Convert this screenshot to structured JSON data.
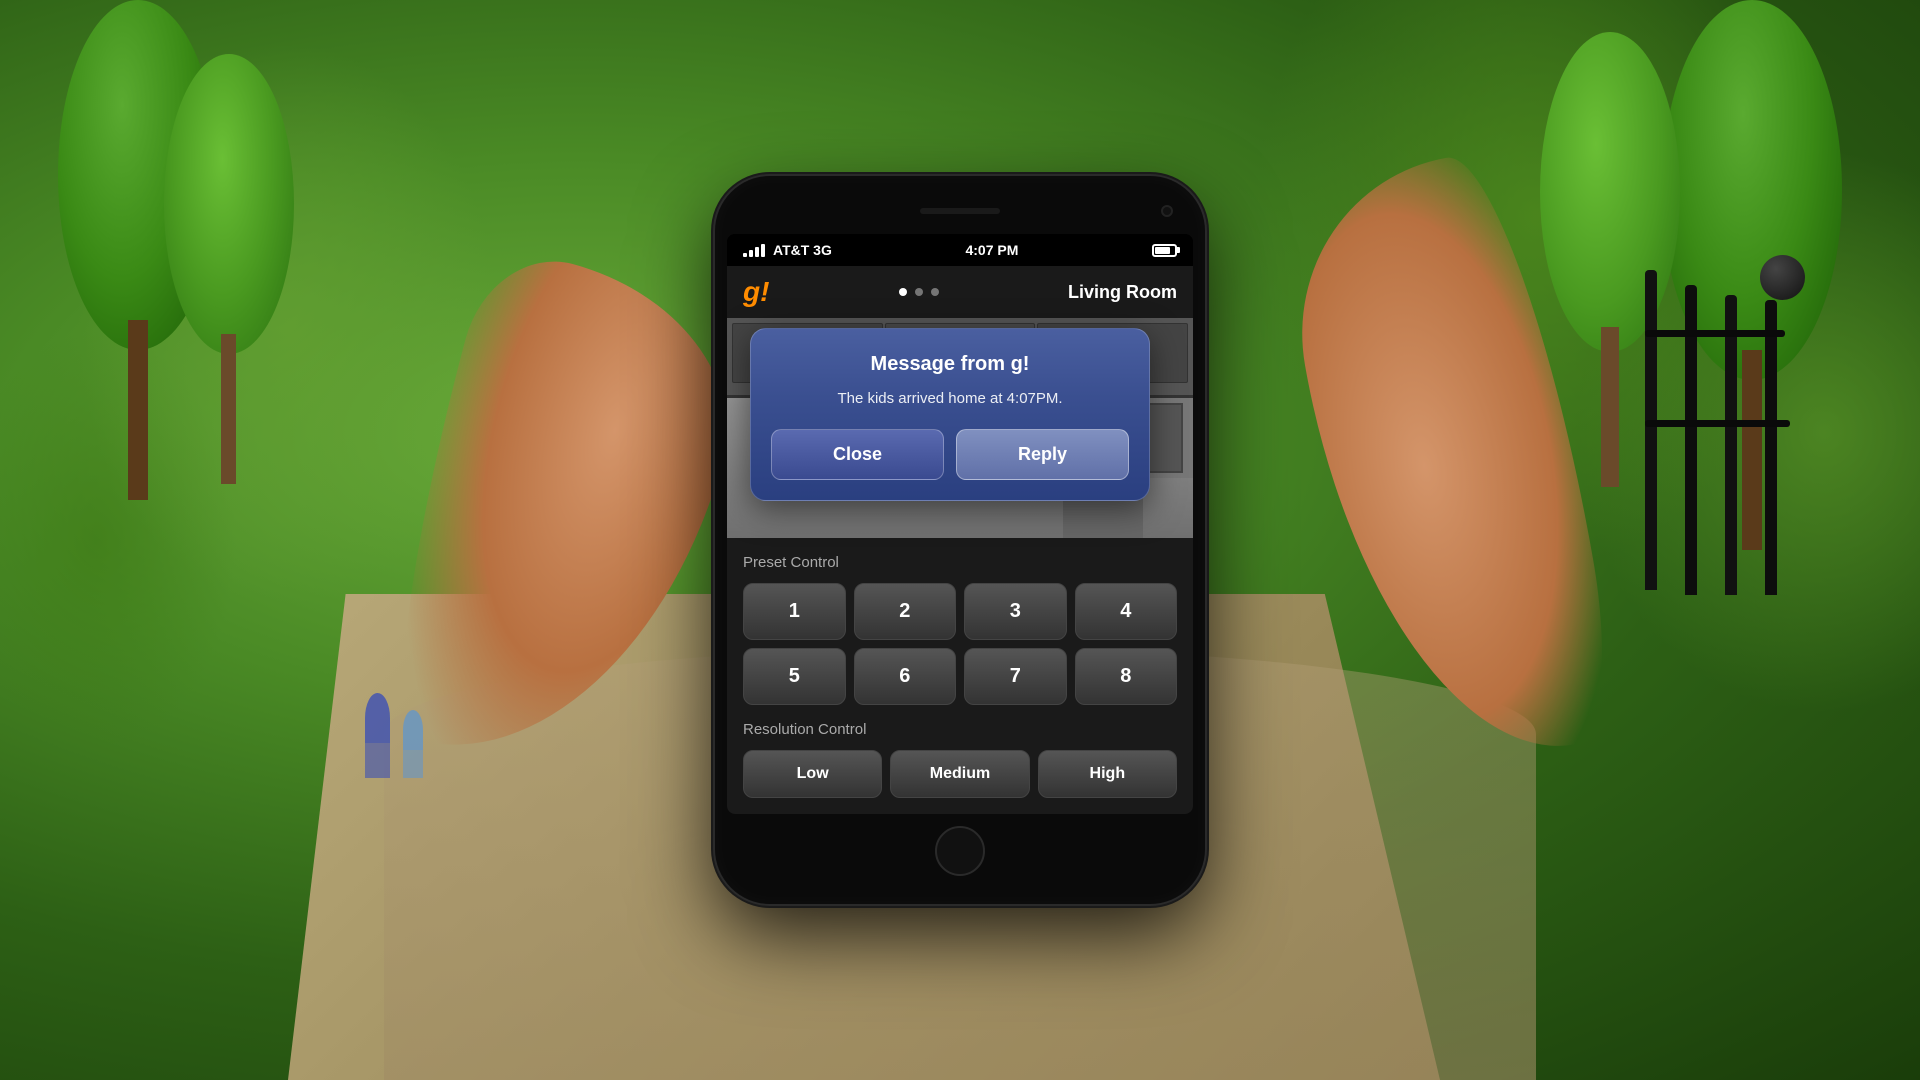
{
  "background": {
    "color": "#3a6e2a"
  },
  "phone": {
    "status_bar": {
      "carrier": "AT&T 3G",
      "time": "4:07 PM",
      "signal_bars": 4,
      "battery_level": 80
    },
    "header": {
      "logo": "g!",
      "room": "Living Room",
      "dots": [
        "active",
        "inactive",
        "inactive"
      ]
    },
    "dialog": {
      "title": "Message from g!",
      "message": "The kids arrived home at 4:07PM.",
      "close_button": "Close",
      "reply_button": "Reply"
    },
    "preset_control": {
      "label": "Preset Control",
      "buttons": [
        "1",
        "2",
        "3",
        "4",
        "5",
        "6",
        "7",
        "8"
      ]
    },
    "resolution_control": {
      "label": "Resolution Control",
      "buttons": [
        "Low",
        "Medium",
        "High"
      ]
    }
  }
}
